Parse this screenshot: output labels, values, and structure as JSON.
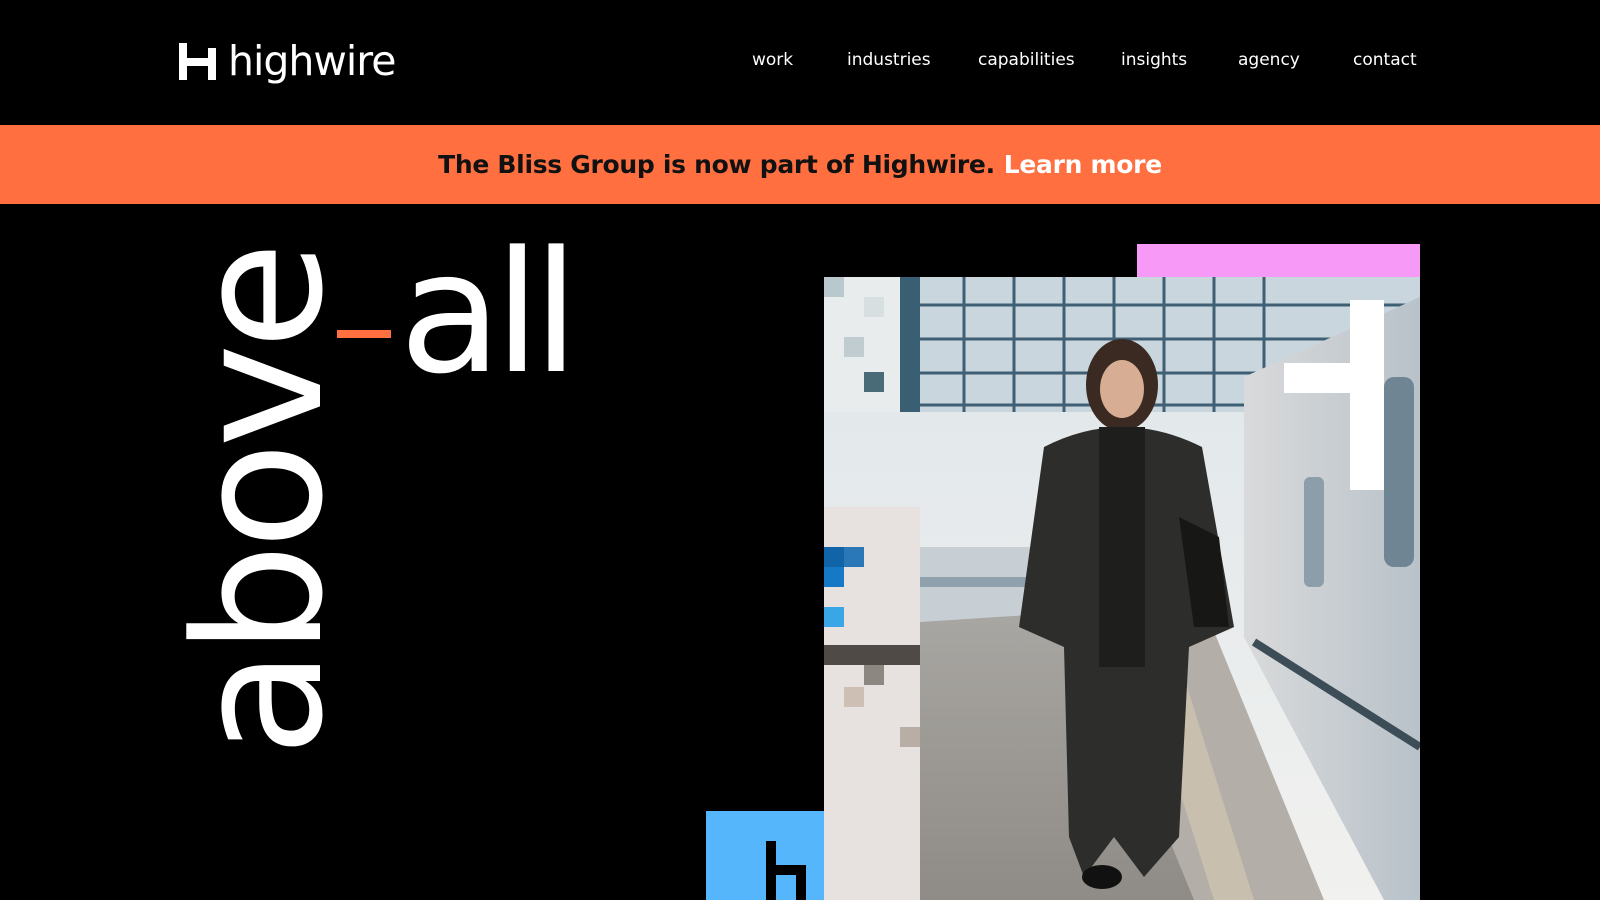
{
  "header": {
    "logo_text": "highwire",
    "logo_icon": "highwire-h-mark-icon",
    "nav": {
      "work": "work",
      "industries": "industries",
      "capabilities": "capabilities",
      "insights": "insights",
      "agency": "agency",
      "contact": "contact"
    }
  },
  "banner": {
    "text": "The Bliss Group is now part of Highwire.",
    "link": "Learn more",
    "background": "#ff6f40"
  },
  "hero": {
    "word_vertical": "above",
    "word_horizontal": "all",
    "accent_color": "#ff6f40",
    "photo_alt": "woman on a phone walking along a train platform",
    "accent_pink": "#f79af7",
    "accent_blue": "#55b6fb"
  }
}
